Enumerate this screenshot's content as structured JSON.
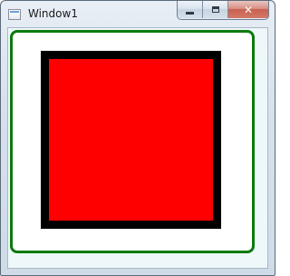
{
  "window": {
    "title": "Window1",
    "icon": "app-window-icon",
    "caption_buttons": {
      "minimize_icon": "minimize-icon",
      "maximize_icon": "maximize-icon",
      "close_icon": "close-icon"
    }
  },
  "colors": {
    "frame_border": "#0b7a0b",
    "square_border": "#000000",
    "square_fill": "#ff0000",
    "client_background": "#eef8fb"
  }
}
